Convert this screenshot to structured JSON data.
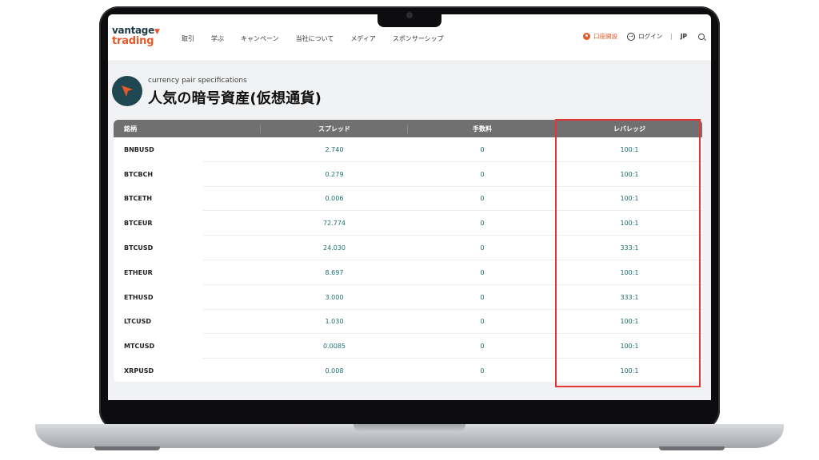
{
  "header": {
    "logo_line1": "vantage",
    "logo_line2": "trading",
    "nav": [
      "取引",
      "学ぶ",
      "キャンペーン",
      "当社について",
      "メディア",
      "スポンサーシップ"
    ],
    "open_account": "口座開設",
    "login": "ログイン",
    "separator": "|",
    "language": "JP"
  },
  "page": {
    "subtitle": "currency pair specifications",
    "title": "人気の暗号資産(仮想通貨)"
  },
  "table": {
    "headers": [
      "銘柄",
      "スプレッド",
      "手数料",
      "レバレッジ"
    ],
    "rows": [
      [
        "BNBUSD",
        "2.740",
        "0",
        "100:1"
      ],
      [
        "BTCBCH",
        "0.279",
        "0",
        "100:1"
      ],
      [
        "BTCETH",
        "0.006",
        "0",
        "100:1"
      ],
      [
        "BTCEUR",
        "72.774",
        "0",
        "100:1"
      ],
      [
        "BTCUSD",
        "24.030",
        "0",
        "333:1"
      ],
      [
        "ETHEUR",
        "8.697",
        "0",
        "100:1"
      ],
      [
        "ETHUSD",
        "3.000",
        "0",
        "333:1"
      ],
      [
        "LTCUSD",
        "1.030",
        "0",
        "100:1"
      ],
      [
        "MTCUSD",
        "0.0085",
        "0",
        "100:1"
      ],
      [
        "XRPUSD",
        "0.008",
        "0",
        "100:1"
      ]
    ]
  },
  "colors": {
    "brand_orange": "#e5582a",
    "brand_teal": "#1f4752",
    "value_teal": "#1a6e70",
    "header_gray": "#707070",
    "highlight_red": "#e53535"
  },
  "icons": {
    "logo_tick": "check-icon",
    "open_account": "person-icon",
    "login": "login-arrow-icon",
    "search": "search-icon",
    "title": "arrow-down-left-icon"
  }
}
